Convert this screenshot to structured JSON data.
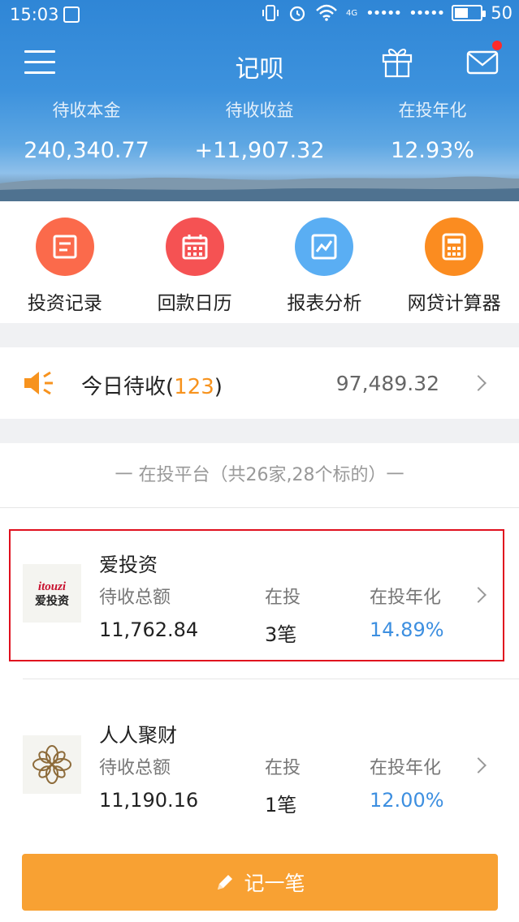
{
  "status_bar": {
    "time": "15:03",
    "network": "4G",
    "signal_text": "•••••",
    "battery_level": "50",
    "battery_fraction": 0.5
  },
  "header": {
    "title": "记呗",
    "stats": [
      {
        "label": "待收本金",
        "value": "240,340.77"
      },
      {
        "label": "待收收益",
        "value": "+11,907.32"
      },
      {
        "label": "在投年化",
        "value": "12.93%"
      }
    ],
    "has_notification": true
  },
  "quick_actions": [
    {
      "label": "投资记录",
      "icon": "doc-list-icon",
      "color": "#fb6a4b"
    },
    {
      "label": "回款日历",
      "icon": "calendar-icon",
      "color": "#f55253"
    },
    {
      "label": "报表分析",
      "icon": "chart-icon",
      "color": "#5aaef3"
    },
    {
      "label": "网贷计算器",
      "icon": "calculator-icon",
      "color": "#fb8c20"
    }
  ],
  "today": {
    "label": "今日待收(",
    "count": "123",
    "suffix": ")",
    "amount": "97,489.32"
  },
  "platforms": {
    "header": "一 在投平台（共26家,28个标的）一",
    "items": [
      {
        "name": "爱投资",
        "logo_text": "itouzi",
        "logo_sub": "爱投资",
        "pending_label": "待收总额",
        "pending_value": "11,762.84",
        "count_label": "在投",
        "count_value": "3笔",
        "rate_label": "在投年化",
        "rate_value": "14.89%"
      },
      {
        "name": "人人聚财",
        "pending_label": "待收总额",
        "pending_value": "11,190.16",
        "count_label": "在投",
        "count_value": "1笔",
        "rate_label": "在投年化",
        "rate_value": "12.00%"
      }
    ]
  },
  "bottom": {
    "add_label": "记一笔"
  },
  "colors": {
    "accent_orange": "#f8a133",
    "rate_blue": "#3d8fe0",
    "highlight_red": "#e0101e"
  }
}
